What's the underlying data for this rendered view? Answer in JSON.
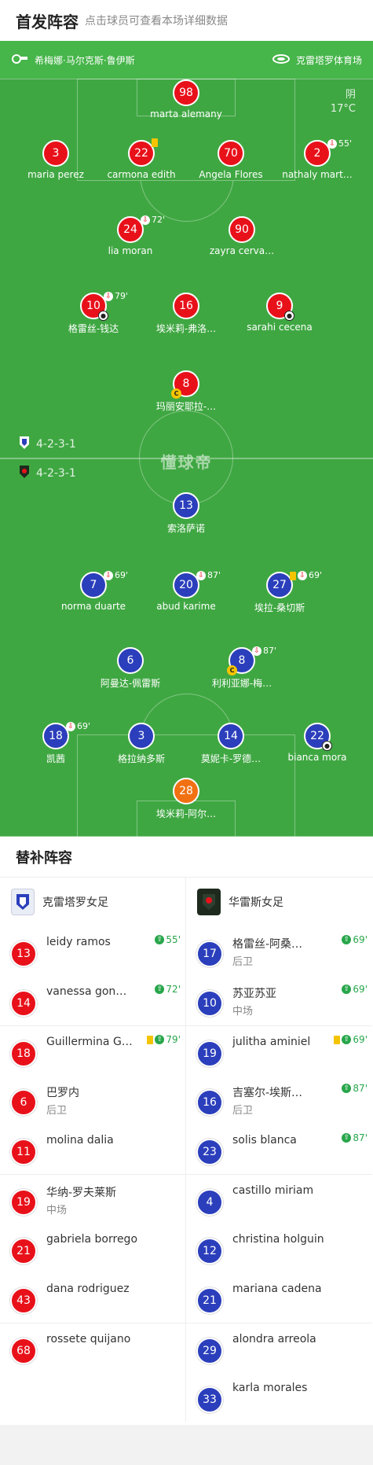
{
  "header": {
    "title": "首发阵容",
    "subtitle": "点击球员可查看本场详细数据"
  },
  "match": {
    "referee": "希梅娜·马尔克斯·鲁伊斯",
    "venue": "克雷塔罗体育场",
    "weather": "阴",
    "temperature": "17°C",
    "watermark": "懂球帝"
  },
  "formations": {
    "home": "4-2-3-1",
    "away": "4-2-3-1"
  },
  "home_players": [
    {
      "number": "98",
      "name": "marta alemany"
    },
    {
      "number": "3",
      "name": "maria perez"
    },
    {
      "number": "22",
      "name": "carmona edith"
    },
    {
      "number": "70",
      "name": "Angela Flores"
    },
    {
      "number": "2",
      "name": "nathaly mart…",
      "sub_time": "55'"
    },
    {
      "number": "24",
      "name": "lia moran",
      "sub_time": "72'"
    },
    {
      "number": "90",
      "name": "zayra cerva…"
    },
    {
      "number": "10",
      "name": "格雷丝-钱达",
      "sub_time": "79'"
    },
    {
      "number": "16",
      "name": "埃米莉-弗洛…"
    },
    {
      "number": "9",
      "name": "sarahi cecena"
    },
    {
      "number": "8",
      "name": "玛丽安耶拉-…"
    }
  ],
  "away_players": [
    {
      "number": "13",
      "name": "索洛萨诺"
    },
    {
      "number": "7",
      "name": "norma duarte",
      "sub_time": "69'"
    },
    {
      "number": "20",
      "name": "abud karime",
      "sub_time": "87'"
    },
    {
      "number": "27",
      "name": "埃拉-桑切斯",
      "sub_time": "69'"
    },
    {
      "number": "6",
      "name": "阿曼达-佩雷斯"
    },
    {
      "number": "8",
      "name": "利利亚娜-梅…",
      "sub_time": "87'"
    },
    {
      "number": "18",
      "name": "凯茜",
      "sub_time": "69'"
    },
    {
      "number": "3",
      "name": "格拉纳多斯"
    },
    {
      "number": "14",
      "name": "莫妮卡-罗德…"
    },
    {
      "number": "22",
      "name": "bianca mora"
    },
    {
      "number": "28",
      "name": "埃米莉-阿尔…"
    }
  ],
  "subs": {
    "title": "替补阵容",
    "home_team": "克雷塔罗女足",
    "away_team": "华雷斯女足",
    "home": [
      {
        "number": "13",
        "name": "leidy ramos",
        "time": "55'"
      },
      {
        "number": "14",
        "name": "vanessa gon…",
        "time": "72'"
      },
      {
        "number": "18",
        "name": "Guillermina G…",
        "time": "79'"
      },
      {
        "number": "6",
        "name": "巴罗内",
        "position": "后卫"
      },
      {
        "number": "11",
        "name": "molina dalia"
      },
      {
        "number": "19",
        "name": "华纳-罗夫莱斯",
        "position": "中场"
      },
      {
        "number": "21",
        "name": "gabriela borrego"
      },
      {
        "number": "43",
        "name": "dana rodriguez"
      },
      {
        "number": "68",
        "name": "rossete quijano"
      }
    ],
    "away": [
      {
        "number": "17",
        "name": "格雷丝-阿桑…",
        "position": "后卫",
        "time": "69'"
      },
      {
        "number": "10",
        "name": "苏亚苏亚",
        "position": "中场",
        "time": "69'"
      },
      {
        "number": "19",
        "name": "julitha aminiel",
        "time": "69'"
      },
      {
        "number": "16",
        "name": "吉塞尔-埃斯…",
        "position": "后卫",
        "time": "87'"
      },
      {
        "number": "23",
        "name": "solis blanca",
        "time": "87'"
      },
      {
        "number": "4",
        "name": "castillo miriam"
      },
      {
        "number": "12",
        "name": "christina holguin"
      },
      {
        "number": "21",
        "name": "mariana cadena"
      },
      {
        "number": "29",
        "name": "alondra arreola"
      },
      {
        "number": "33",
        "name": "karla morales"
      }
    ]
  }
}
